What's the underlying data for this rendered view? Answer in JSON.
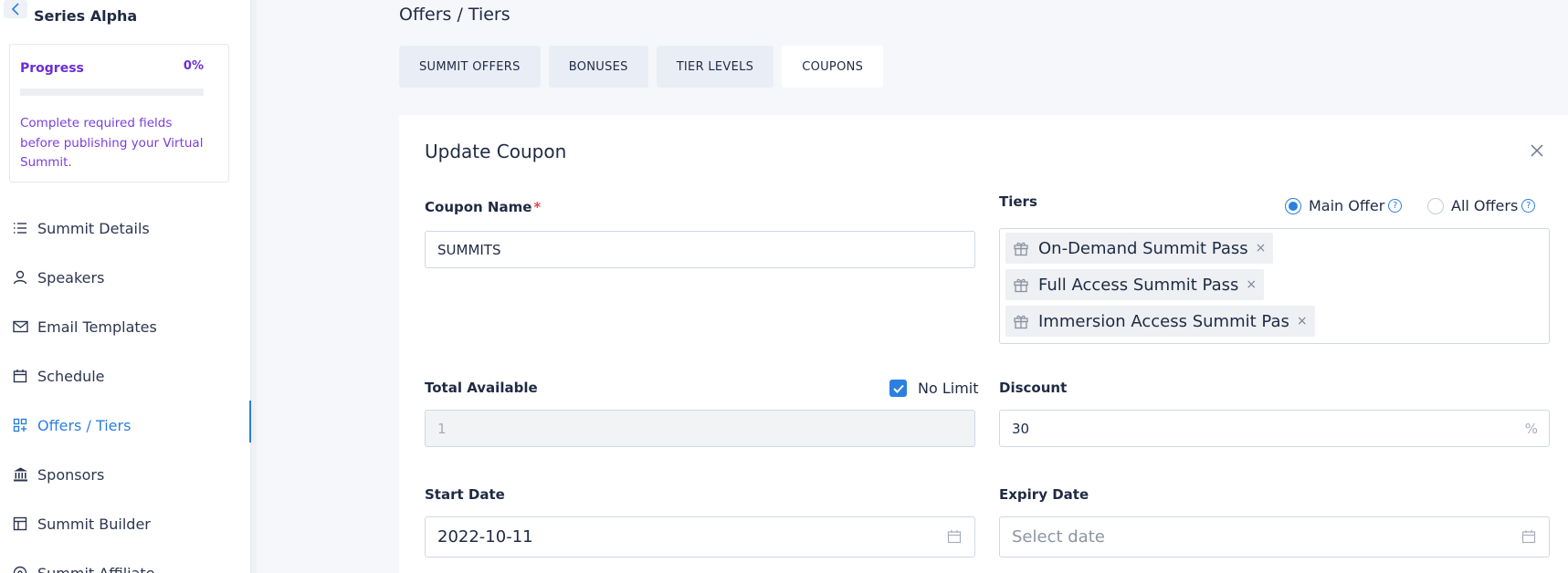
{
  "sidebar": {
    "back_icon": "chevron-left-icon",
    "project_name": "Series Alpha",
    "progress": {
      "label": "Progress",
      "percent_text": "0%",
      "value": 0,
      "message": "Complete required fields before publishing your Virtual Summit."
    },
    "items": [
      {
        "label": "Summit Details",
        "icon": "list-icon"
      },
      {
        "label": "Speakers",
        "icon": "user-icon"
      },
      {
        "label": "Email Templates",
        "icon": "mail-icon"
      },
      {
        "label": "Schedule",
        "icon": "calendar-icon"
      },
      {
        "label": "Offers / Tiers",
        "icon": "offers-icon",
        "active": true
      },
      {
        "label": "Sponsors",
        "icon": "bank-icon"
      },
      {
        "label": "Summit Builder",
        "icon": "layout-icon"
      },
      {
        "label": "Summit Affiliate",
        "icon": "affiliate-icon"
      }
    ]
  },
  "main": {
    "breadcrumb": "Offers / Tiers",
    "tabs": [
      {
        "label": "SUMMIT OFFERS"
      },
      {
        "label": "BONUSES"
      },
      {
        "label": "TIER LEVELS"
      },
      {
        "label": "COUPONS",
        "active": true
      }
    ]
  },
  "form": {
    "title": "Update Coupon",
    "coupon_name_label": "Coupon Name",
    "required_mark": "*",
    "coupon_name_value": "SUMMITS",
    "tiers_label": "Tiers",
    "radio_main": "Main Offer",
    "radio_all": "All Offers",
    "tiers": [
      "On-Demand Summit Pass",
      "Full Access Summit Pass",
      "Immersion Access Summit Pas"
    ],
    "total_available_label": "Total Available",
    "no_limit_label": "No Limit",
    "total_available_value": "1",
    "discount_label": "Discount",
    "discount_value": "30",
    "discount_suffix": "%",
    "start_date_label": "Start Date",
    "start_date_value": "2022-10-11",
    "expiry_date_label": "Expiry Date",
    "expiry_placeholder": "Select date"
  },
  "colors": {
    "accent": "#2b7fe0",
    "progress_purple": "#6a2ed6",
    "required_red": "#e5484d"
  }
}
